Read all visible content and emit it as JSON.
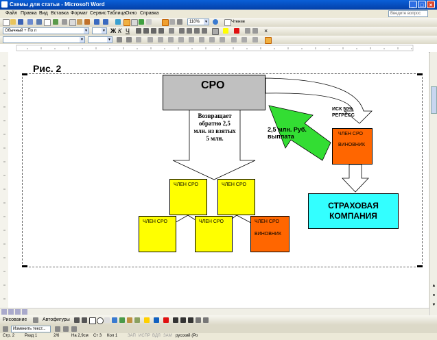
{
  "window": {
    "title": "Схемы для статьи - Microsoft Word"
  },
  "menu": [
    "Файл",
    "Правка",
    "Вид",
    "Вставка",
    "Формат",
    "Сервис",
    "Таблица",
    "Окно",
    "Справка"
  ],
  "help_placeholder": "Введите вопрос",
  "toolbar": {
    "style_value": "Обычный + По л",
    "zoom_value": "110%",
    "reading_label": "Чтение"
  },
  "diagram": {
    "figure_label": "Рис. 2",
    "sro_label": "СРО",
    "returns_text": "Возвращает обратно 2,5 млн. из взятых 5 млн.",
    "payment_text": "2,5 млн. Руб. выплата",
    "claim_text": "ИСК 50% РЕГРЕСС",
    "member_culprit_top": {
      "line1": "ЧЛЕН СРО",
      "line2": "ВИНОВНИК"
    },
    "insurance_text": "СТРАХОВАЯ КОМПАНИЯ",
    "members": [
      "ЧЛЕН СРО",
      "ЧЛЕН СРО",
      "ЧЛЕН СРО",
      "ЧЛЕН СРО"
    ],
    "member_culprit_bottom": {
      "line1": "ЧЛЕН СРО",
      "line2": "ВИНОВНИК"
    },
    "colors": {
      "sro_fill": "#c0c0c0",
      "member_fill": "#ffff00",
      "culprit_fill": "#ff6600",
      "insurance_fill": "#33ffff",
      "arrow_fill": "#33dd33"
    }
  },
  "drawing_toolbar": {
    "draw_label": "Рисование",
    "autoshapes_label": "Автофигуры"
  },
  "taskpane": {
    "change_text_label": "Изменить текст..."
  },
  "status": {
    "page": "Стр. 2",
    "section": "Разд 1",
    "pages": "2/6",
    "at": "На 2,9см",
    "line": "Ст 3",
    "col": "Кол 1",
    "rec": "ЗАП",
    "trk": "ИСПР",
    "ext": "ВДЛ",
    "ovr": "ЗАМ",
    "language": "русский (Ро"
  }
}
